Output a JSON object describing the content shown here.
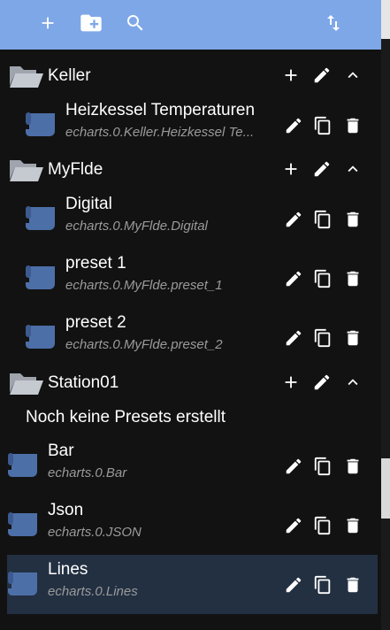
{
  "toolbar": {
    "icons": [
      "add-icon",
      "create-folder-icon",
      "search-icon",
      "sort-icon"
    ],
    "color": "#7ea7e8"
  },
  "folders": [
    {
      "name": "Keller",
      "presets": [
        {
          "title": "Heizkessel Temperaturen",
          "path": "echarts.0.Keller.Heizkessel Te..."
        }
      ]
    },
    {
      "name": "MyFlde",
      "presets": [
        {
          "title": "Digital",
          "path": "echarts.0.MyFlde.Digital"
        },
        {
          "title": "preset 1",
          "path": "echarts.0.MyFlde.preset_1"
        },
        {
          "title": "preset 2",
          "path": "echarts.0.MyFlde.preset_2"
        }
      ]
    },
    {
      "name": "Station01",
      "empty_text": "Noch keine Presets erstellt"
    }
  ],
  "root_presets": [
    {
      "title": "Bar",
      "path": "echarts.0.Bar"
    },
    {
      "title": "Json",
      "path": "echarts.0.JSON"
    },
    {
      "title": "Lines",
      "path": "echarts.0.Lines",
      "selected": true
    }
  ],
  "colors": {
    "background": "#121212",
    "icon_blue": "#4d6fa8",
    "folder_grey": "#b8bcc4",
    "selected_row": "#233042",
    "subtitle": "#9a9a9a"
  }
}
